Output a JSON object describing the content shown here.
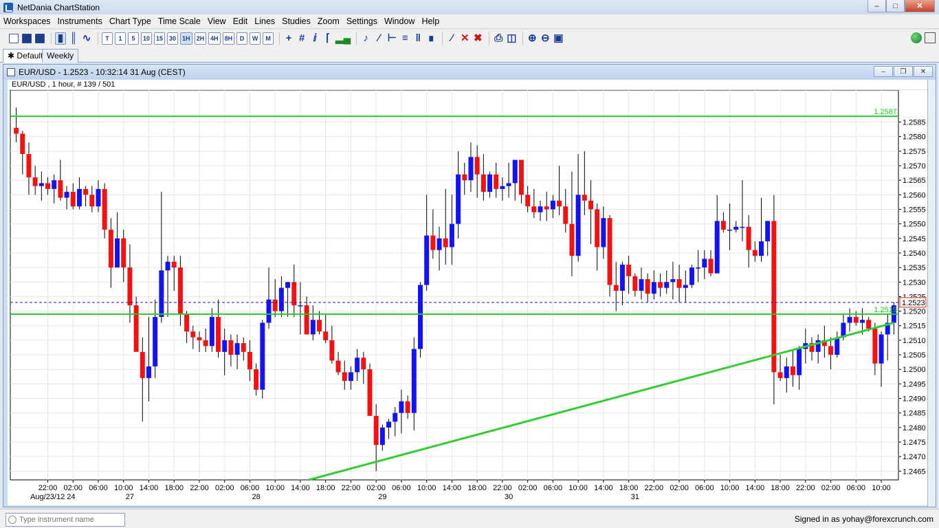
{
  "window": {
    "title": "NetDania ChartStation"
  },
  "menu": [
    "Workspaces",
    "Instruments",
    "Chart Type",
    "Time Scale",
    "View",
    "Edit",
    "Lines",
    "Studies",
    "Zoom",
    "Settings",
    "Window",
    "Help"
  ],
  "toolbar": {
    "timeframes": [
      "T",
      "1",
      "5",
      "10",
      "15",
      "30",
      "1H",
      "2H",
      "4H",
      "8H",
      "D",
      "W",
      "M"
    ],
    "active_timeframe": "1H"
  },
  "tabs": [
    {
      "label": "Default",
      "active": true
    },
    {
      "label": "Weekly",
      "active": false
    }
  ],
  "chart_window": {
    "title": "EUR/USD - 1.2523 - 10:32:14  31 Aug (CEST)",
    "subtitle": "EUR/USD , 1 hour, # 139 / 501"
  },
  "chart_data": {
    "type": "candlestick",
    "instrument": "EUR/USD",
    "ylim": [
      1.2462,
      1.2596
    ],
    "y_ticks": [
      "1.2585",
      "1.2580",
      "1.2575",
      "1.2570",
      "1.2565",
      "1.2560",
      "1.2555",
      "1.2550",
      "1.2545",
      "1.2540",
      "1.2535",
      "1.2530",
      "1.2525",
      "1.2520",
      "1.2515",
      "1.2510",
      "1.2505",
      "1.2500",
      "1.2495",
      "1.2490",
      "1.2485",
      "1.2480",
      "1.2475",
      "1.2470",
      "1.2465"
    ],
    "x_time_labels": [
      "22:00",
      "02:00",
      "06:00",
      "10:00",
      "14:00",
      "18:00",
      "22:00",
      "02:00",
      "06:00",
      "10:00",
      "14:00",
      "18:00",
      "22:00",
      "02:00",
      "06:00",
      "10:00",
      "14:00",
      "18:00",
      "22:00",
      "02:00",
      "06:00",
      "10:00",
      "14:00",
      "18:00",
      "22:00",
      "02:00",
      "06:00",
      "10:00",
      "14:00",
      "18:00",
      "22:00",
      "02:00",
      "06:00",
      "10:00"
    ],
    "x_date_labels": [
      "Aug/23/12  24",
      "27",
      "28",
      "29",
      "30",
      "31"
    ],
    "horizontal_lines": [
      {
        "label": "1.2587",
        "value": 1.2587,
        "color": "#22cc22"
      },
      {
        "label": "1.2519",
        "value": 1.2519,
        "color": "#22cc22"
      }
    ],
    "trendline": {
      "start": 1.2435,
      "end": 1.2516,
      "color": "#33cc33"
    },
    "current_price": {
      "label": "1.2523",
      "value": 1.2523
    },
    "colors": {
      "up": "#1414ee",
      "down": "#ee1414",
      "wick": "#000000",
      "grid": "#e6e6e6"
    },
    "candles": [
      [
        1.2583,
        1.259,
        1.2578,
        1.2581
      ],
      [
        1.2581,
        1.2582,
        1.2567,
        1.2574
      ],
      [
        1.2574,
        1.2578,
        1.256,
        1.2566
      ],
      [
        1.2566,
        1.257,
        1.256,
        1.2563
      ],
      [
        1.2563,
        1.2568,
        1.2558,
        1.2564
      ],
      [
        1.2564,
        1.2566,
        1.256,
        1.2562
      ],
      [
        1.2562,
        1.2567,
        1.2557,
        1.2565
      ],
      [
        1.2565,
        1.2572,
        1.2558,
        1.2559
      ],
      [
        1.2559,
        1.2563,
        1.2555,
        1.2561
      ],
      [
        1.2561,
        1.2564,
        1.2555,
        1.2556
      ],
      [
        1.2556,
        1.2566,
        1.2555,
        1.2562
      ],
      [
        1.2562,
        1.2563,
        1.2556,
        1.256
      ],
      [
        1.256,
        1.2563,
        1.2554,
        1.2556
      ],
      [
        1.2556,
        1.2565,
        1.2554,
        1.2562
      ],
      [
        1.2562,
        1.2564,
        1.2545,
        1.2548
      ],
      [
        1.2548,
        1.2552,
        1.2528,
        1.2535
      ],
      [
        1.2535,
        1.2554,
        1.2535,
        1.2545
      ],
      [
        1.2545,
        1.2548,
        1.253,
        1.2535
      ],
      [
        1.2535,
        1.2543,
        1.2516,
        1.2522
      ],
      [
        1.2522,
        1.2525,
        1.2509,
        1.2506
      ],
      [
        1.2506,
        1.2511,
        1.2482,
        1.2497
      ],
      [
        1.2497,
        1.2518,
        1.2489,
        1.2501
      ],
      [
        1.2501,
        1.2524,
        1.2497,
        1.2518
      ],
      [
        1.2518,
        1.2561,
        1.2516,
        1.2534
      ],
      [
        1.2534,
        1.2539,
        1.2518,
        1.2537
      ],
      [
        1.2537,
        1.2539,
        1.2527,
        1.2535
      ],
      [
        1.2535,
        1.2539,
        1.2515,
        1.2519
      ],
      [
        1.2519,
        1.252,
        1.2509,
        1.2513
      ],
      [
        1.2513,
        1.2515,
        1.2507,
        1.2511
      ],
      [
        1.2511,
        1.2513,
        1.2506,
        1.251
      ],
      [
        1.251,
        1.2514,
        1.2506,
        1.2508
      ],
      [
        1.2508,
        1.2521,
        1.2506,
        1.2518
      ],
      [
        1.2518,
        1.2524,
        1.2504,
        1.2506
      ],
      [
        1.2506,
        1.2514,
        1.2498,
        1.251
      ],
      [
        1.251,
        1.2512,
        1.2501,
        1.2505
      ],
      [
        1.2505,
        1.2512,
        1.25,
        1.2509
      ],
      [
        1.2509,
        1.2511,
        1.2503,
        1.2506
      ],
      [
        1.2506,
        1.251,
        1.2496,
        1.25
      ],
      [
        1.25,
        1.2502,
        1.2491,
        1.2493
      ],
      [
        1.2493,
        1.2517,
        1.249,
        1.2516
      ],
      [
        1.2516,
        1.2535,
        1.2514,
        1.2524
      ],
      [
        1.2524,
        1.2531,
        1.2518,
        1.252
      ],
      [
        1.252,
        1.2532,
        1.2518,
        1.2528
      ],
      [
        1.2528,
        1.253,
        1.2518,
        1.253
      ],
      [
        1.253,
        1.2536,
        1.2518,
        1.2522
      ],
      [
        1.2522,
        1.253,
        1.2512,
        1.2522
      ],
      [
        1.2522,
        1.2525,
        1.2512,
        1.2512
      ],
      [
        1.2512,
        1.2522,
        1.251,
        1.2517
      ],
      [
        1.2517,
        1.252,
        1.2512,
        1.2513
      ],
      [
        1.2513,
        1.2519,
        1.2509,
        1.251
      ],
      [
        1.251,
        1.2515,
        1.2502,
        1.2503
      ],
      [
        1.2503,
        1.2506,
        1.2498,
        1.2499
      ],
      [
        1.2499,
        1.2503,
        1.2493,
        1.2496
      ],
      [
        1.2496,
        1.2501,
        1.2493,
        1.2499
      ],
      [
        1.2499,
        1.2507,
        1.2496,
        1.2504
      ],
      [
        1.2504,
        1.2506,
        1.2495,
        1.25
      ],
      [
        1.25,
        1.2502,
        1.2484,
        1.2484
      ],
      [
        1.2484,
        1.2488,
        1.2465,
        1.2474
      ],
      [
        1.2474,
        1.2481,
        1.2472,
        1.248
      ],
      [
        1.248,
        1.2483,
        1.2476,
        1.2482
      ],
      [
        1.2482,
        1.2487,
        1.2477,
        1.2485
      ],
      [
        1.2485,
        1.2493,
        1.2478,
        1.2489
      ],
      [
        1.2489,
        1.2491,
        1.2483,
        1.2485
      ],
      [
        1.2485,
        1.2511,
        1.2479,
        1.2507
      ],
      [
        1.2507,
        1.253,
        1.2504,
        1.2529
      ],
      [
        1.2529,
        1.256,
        1.2527,
        1.2546
      ],
      [
        1.2546,
        1.2555,
        1.2538,
        1.2541
      ],
      [
        1.2541,
        1.2549,
        1.2534,
        1.2545
      ],
      [
        1.2545,
        1.2562,
        1.2536,
        1.2542
      ],
      [
        1.2542,
        1.256,
        1.2536,
        1.255
      ],
      [
        1.255,
        1.2575,
        1.2545,
        1.2567
      ],
      [
        1.2567,
        1.2571,
        1.256,
        1.2565
      ],
      [
        1.2565,
        1.2578,
        1.2561,
        1.2573
      ],
      [
        1.2573,
        1.2577,
        1.2559,
        1.2567
      ],
      [
        1.2567,
        1.2574,
        1.2558,
        1.2561
      ],
      [
        1.2561,
        1.2568,
        1.2559,
        1.2567
      ],
      [
        1.2567,
        1.2571,
        1.2559,
        1.2562
      ],
      [
        1.2562,
        1.2566,
        1.2558,
        1.2563
      ],
      [
        1.2563,
        1.2571,
        1.2559,
        1.2564
      ],
      [
        1.2564,
        1.2571,
        1.2558,
        1.2572
      ],
      [
        1.2572,
        1.2572,
        1.2557,
        1.256
      ],
      [
        1.256,
        1.2563,
        1.2554,
        1.2556
      ],
      [
        1.2556,
        1.2562,
        1.2552,
        1.2554
      ],
      [
        1.2554,
        1.2558,
        1.2551,
        1.2556
      ],
      [
        1.2556,
        1.2561,
        1.2551,
        1.2555
      ],
      [
        1.2555,
        1.256,
        1.2552,
        1.2558
      ],
      [
        1.2558,
        1.257,
        1.2553,
        1.2556
      ],
      [
        1.2556,
        1.2562,
        1.2547,
        1.255
      ],
      [
        1.255,
        1.2568,
        1.2532,
        1.2539
      ],
      [
        1.2539,
        1.2574,
        1.2537,
        1.256
      ],
      [
        1.256,
        1.2575,
        1.2553,
        1.2558
      ],
      [
        1.2558,
        1.2565,
        1.2543,
        1.2555
      ],
      [
        1.2555,
        1.2557,
        1.2534,
        1.2542
      ],
      [
        1.2542,
        1.2556,
        1.2538,
        1.2552
      ],
      [
        1.2552,
        1.2553,
        1.2525,
        1.2529
      ],
      [
        1.2529,
        1.2537,
        1.252,
        1.2527
      ],
      [
        1.2527,
        1.2537,
        1.2522,
        1.2536
      ],
      [
        1.2536,
        1.2539,
        1.2526,
        1.2532
      ],
      [
        1.2532,
        1.2533,
        1.2525,
        1.2527
      ],
      [
        1.2527,
        1.2535,
        1.2524,
        1.2531
      ],
      [
        1.2531,
        1.2533,
        1.2523,
        1.2526
      ],
      [
        1.2526,
        1.2534,
        1.2524,
        1.253
      ],
      [
        1.253,
        1.2533,
        1.2525,
        1.2528
      ],
      [
        1.2528,
        1.2534,
        1.2526,
        1.253
      ],
      [
        1.253,
        1.2537,
        1.2524,
        1.2531
      ],
      [
        1.2531,
        1.2536,
        1.2523,
        1.2528
      ],
      [
        1.2528,
        1.2534,
        1.2523,
        1.2529
      ],
      [
        1.2529,
        1.2536,
        1.2528,
        1.2535
      ],
      [
        1.2535,
        1.2541,
        1.253,
        1.2535
      ],
      [
        1.2535,
        1.2541,
        1.2531,
        1.2538
      ],
      [
        1.2538,
        1.2541,
        1.2532,
        1.2533
      ],
      [
        1.2533,
        1.256,
        1.2533,
        1.2551
      ],
      [
        1.2551,
        1.2554,
        1.2547,
        1.2548
      ],
      [
        1.2548,
        1.2557,
        1.2541,
        1.2548
      ],
      [
        1.2548,
        1.2551,
        1.2547,
        1.2549
      ],
      [
        1.2549,
        1.2565,
        1.2544,
        1.2549
      ],
      [
        1.2549,
        1.2553,
        1.2535,
        1.2541
      ],
      [
        1.2541,
        1.2544,
        1.2537,
        1.2539
      ],
      [
        1.2539,
        1.2559,
        1.2537,
        1.2544
      ],
      [
        1.2544,
        1.255,
        1.2539,
        1.2551
      ],
      [
        1.2551,
        1.256,
        1.2488,
        1.2499
      ],
      [
        1.2499,
        1.2505,
        1.2496,
        1.2497
      ],
      [
        1.2497,
        1.2504,
        1.2492,
        1.2501
      ],
      [
        1.2501,
        1.2507,
        1.2494,
        1.2498
      ],
      [
        1.2498,
        1.2508,
        1.2493,
        1.2507
      ],
      [
        1.2507,
        1.2514,
        1.2502,
        1.2509
      ],
      [
        1.2509,
        1.2511,
        1.2503,
        1.2506
      ],
      [
        1.2506,
        1.2512,
        1.2502,
        1.251
      ],
      [
        1.251,
        1.2515,
        1.2504,
        1.2508
      ],
      [
        1.2508,
        1.2511,
        1.25,
        1.2505
      ],
      [
        1.2505,
        1.2513,
        1.2504,
        1.2511
      ],
      [
        1.2511,
        1.2519,
        1.251,
        1.2516
      ],
      [
        1.2516,
        1.2521,
        1.2513,
        1.2518
      ],
      [
        1.2518,
        1.252,
        1.2515,
        1.2516
      ],
      [
        1.2516,
        1.2521,
        1.2512,
        1.2517
      ],
      [
        1.2517,
        1.2518,
        1.2513,
        1.2514
      ],
      [
        1.2514,
        1.2516,
        1.2498,
        1.2502
      ],
      [
        1.2502,
        1.2513,
        1.2494,
        1.2512
      ],
      [
        1.2512,
        1.2519,
        1.2503,
        1.2516
      ],
      [
        1.2516,
        1.2523,
        1.2512,
        1.2522
      ]
    ]
  },
  "bottom": {
    "search_placeholder": "Type instrument name",
    "signed_in": "Signed in as yohay@forexcrunch.com"
  }
}
